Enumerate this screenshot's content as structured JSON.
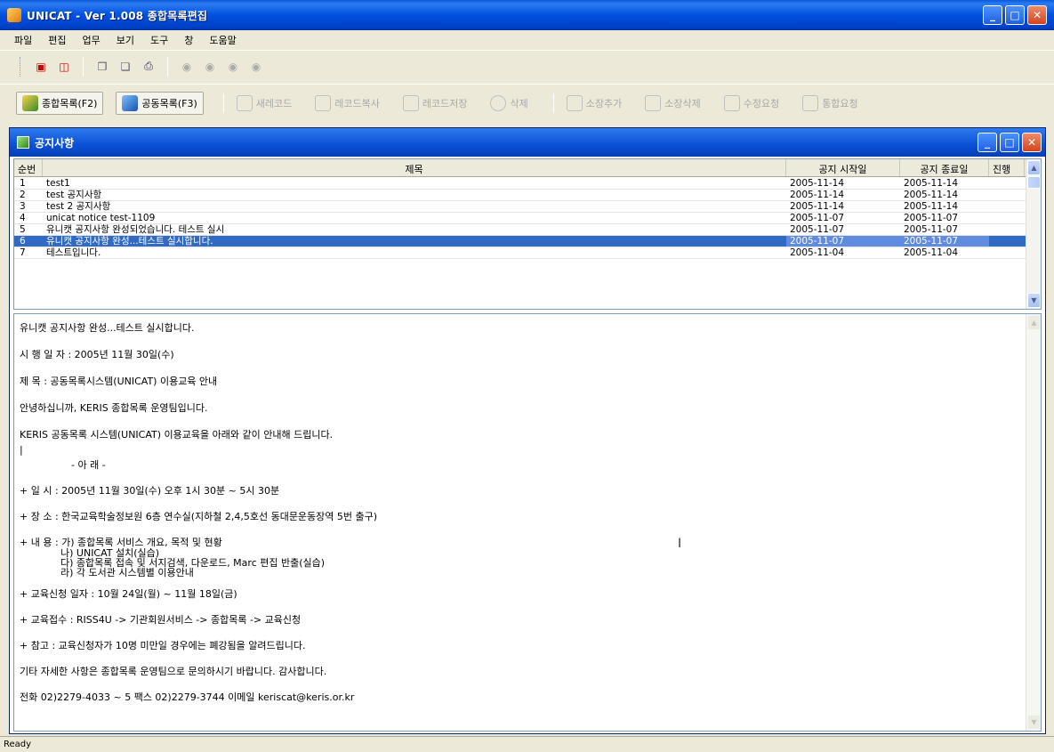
{
  "window": {
    "title": "UNICAT - Ver 1.008  종합목록편집",
    "minimize": "_",
    "maximize": "□",
    "close": "✕"
  },
  "menu": [
    "파일",
    "편집",
    "업무",
    "보기",
    "도구",
    "창",
    "도움말"
  ],
  "toolbar_small": {
    "icons": [
      "book-icon",
      "print-preview-icon",
      "copy-icon",
      "print-icon",
      "nav-first-icon",
      "nav-prev-icon",
      "nav-next-icon",
      "nav-last-icon"
    ]
  },
  "toolbar_main": {
    "buttons": [
      {
        "label": "종합목록(F2)",
        "icon": "catalog-icon",
        "enabled": true
      },
      {
        "label": "공동목록(F3)",
        "icon": "shared-catalog-icon",
        "enabled": true
      },
      {
        "label": "새레코드",
        "icon": "new-record-icon",
        "enabled": false
      },
      {
        "label": "레코드복사",
        "icon": "copy-record-icon",
        "enabled": false
      },
      {
        "label": "레코드저장",
        "icon": "save-record-icon",
        "enabled": false
      },
      {
        "label": "삭제",
        "icon": "delete-icon",
        "enabled": false
      },
      {
        "label": "소장추가",
        "icon": "add-holding-icon",
        "enabled": false
      },
      {
        "label": "소장삭제",
        "icon": "delete-holding-icon",
        "enabled": false
      },
      {
        "label": "수정요청",
        "icon": "edit-request-icon",
        "enabled": false
      },
      {
        "label": "통합요청",
        "icon": "merge-request-icon",
        "enabled": false
      }
    ]
  },
  "child_window": {
    "title": "공지사항"
  },
  "notice_list": {
    "columns": [
      "순번",
      "제목",
      "공지 시작일",
      "공지 종료일",
      "진행"
    ],
    "rows": [
      {
        "num": "1",
        "title": "test1",
        "start": "2005-11-14",
        "end": "2005-11-14",
        "selected": false
      },
      {
        "num": "2",
        "title": "test 공지사항",
        "start": "2005-11-14",
        "end": "2005-11-14",
        "selected": false
      },
      {
        "num": "3",
        "title": "test 2 공지사항",
        "start": "2005-11-14",
        "end": "2005-11-14",
        "selected": false
      },
      {
        "num": "4",
        "title": "unicat notice test-1109",
        "start": "2005-11-07",
        "end": "2005-11-07",
        "selected": false
      },
      {
        "num": "5",
        "title": "유니캣 공지사항 완성되었습니다. 테스트 실시",
        "start": "2005-11-07",
        "end": "2005-11-07",
        "selected": false
      },
      {
        "num": "6",
        "title": "유니캣 공지사항 완성...테스트 실시합니다.",
        "start": "2005-11-07",
        "end": "2005-11-07",
        "selected": true
      },
      {
        "num": "7",
        "title": "테스트입니다.",
        "start": "2005-11-04",
        "end": "2005-11-04",
        "selected": false
      }
    ]
  },
  "notice_detail": {
    "lines": [
      "유니캣 공지사항 완성...테스트 실시합니다.",
      "시 행 일 자 : 2005년 11월 30일(수)",
      "제      목 : 공동목록시스템(UNICAT) 이용교육 안내",
      "안녕하십니까, KERIS 종합목록 운영팀입니다.",
      "KERIS 공동목록 시스템(UNICAT) 이용교육을 아래와 같이 안내해 드립니다."
    ],
    "separator_mark": "|",
    "section_heading": "- 아                    래 -",
    "items": [
      "+ 일 시 : 2005년 11월 30일(수) 오후 1시 30분 ~ 5시 30분",
      "+ 장 소 : 한국교육학술정보원 6층 연수실(지하철 2,4,5호선 동대문운동장역 5번 출구)",
      "+ 내 용 : 가) 종합목록 서비스 개요, 목적 및 현황"
    ],
    "subitems": [
      "나) UNICAT 설치(실습)",
      "다) 종합목록 접속 및 서지검색, 다운로드, Marc 편집 반출(실습)",
      "라) 각 도서관 시스템별 이용안내"
    ],
    "items2": [
      "+ 교육신청 일자 :  10월 24일(월) ~ 11월 18일(금)",
      "+ 교육접수 : RISS4U -> 기관회원서비스 -> 종합목록 -> 교육신청",
      "+ 참고 :  교육신청자가 10명 미만일 경우에는 폐강됨을 알려드립니다.",
      "기타 자세한 사항은 종합목록 운영팀으로 문의하시기 바랍니다. 감사합니다.",
      "전화 02)2279-4033 ~ 5  팩스 02)2279-3744  이메일 keriscat@keris.or.kr"
    ],
    "cursor_glyph": "I"
  },
  "status": {
    "text": "Ready"
  }
}
